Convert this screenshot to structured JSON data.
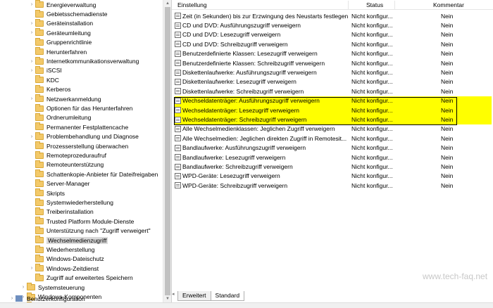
{
  "tree": {
    "items": [
      {
        "label": "Energieverwaltung",
        "expandable": true
      },
      {
        "label": "Gebietsschemadienste",
        "expandable": false
      },
      {
        "label": "Geräteinstallation",
        "expandable": true
      },
      {
        "label": "Geräteumleitung",
        "expandable": true
      },
      {
        "label": "Gruppenrichtlinie",
        "expandable": false
      },
      {
        "label": "Herunterfahren",
        "expandable": false
      },
      {
        "label": "Internetkommunikationsverwaltung",
        "expandable": true
      },
      {
        "label": "iSCSI",
        "expandable": true
      },
      {
        "label": "KDC",
        "expandable": false
      },
      {
        "label": "Kerberos",
        "expandable": false
      },
      {
        "label": "Netzwerkanmeldung",
        "expandable": true
      },
      {
        "label": "Optionen für das Herunterfahren",
        "expandable": false
      },
      {
        "label": "Ordnerumleitung",
        "expandable": false
      },
      {
        "label": "Permanenter Festplattencache",
        "expandable": false
      },
      {
        "label": "Problembehandlung und Diagnose",
        "expandable": true
      },
      {
        "label": "Prozesserstellung überwachen",
        "expandable": false
      },
      {
        "label": "Remoteprozeduraufruf",
        "expandable": false
      },
      {
        "label": "Remoteunterstützung",
        "expandable": false
      },
      {
        "label": "Schattenkopie-Anbieter für Dateifreigaben",
        "expandable": false
      },
      {
        "label": "Server-Manager",
        "expandable": false
      },
      {
        "label": "Skripts",
        "expandable": false
      },
      {
        "label": "Systemwiederherstellung",
        "expandable": false
      },
      {
        "label": "Treiberinstallation",
        "expandable": false
      },
      {
        "label": "Trusted Platform Module-Dienste",
        "expandable": false
      },
      {
        "label": "Unterstützung nach \"Zugriff verweigert\"",
        "expandable": false
      },
      {
        "label": "Wechselmedienzugriff",
        "expandable": false,
        "selected": true
      },
      {
        "label": "Wiederherstellung",
        "expandable": false
      },
      {
        "label": "Windows-Dateischutz",
        "expandable": false
      },
      {
        "label": "Windows-Zeitdienst",
        "expandable": true
      },
      {
        "label": "Zugriff auf erweitertes Speichern",
        "expandable": false
      },
      {
        "label": "Systemsteuerung",
        "expandable": true
      },
      {
        "label": "Windows-Komponenten",
        "expandable": true
      },
      {
        "label": "Alle Einstellungen",
        "expandable": false
      }
    ],
    "bottom_item": "Benutzerkonfiguration"
  },
  "columns": {
    "setting": "Einstellung",
    "status": "Status",
    "comment": "Kommentar"
  },
  "rows": [
    {
      "name": "Zeit (in Sekunden) bis zur Erzwingung des Neustarts festlegen",
      "status": "Nicht konfigur...",
      "comment": "Nein"
    },
    {
      "name": "CD und DVD: Ausführungszugriff verweigern",
      "status": "Nicht konfigur...",
      "comment": "Nein"
    },
    {
      "name": "CD und DVD: Lesezugriff verweigern",
      "status": "Nicht konfigur...",
      "comment": "Nein"
    },
    {
      "name": "CD und DVD: Schreibzugriff verweigern",
      "status": "Nicht konfigur...",
      "comment": "Nein"
    },
    {
      "name": "Benutzerdefinierte Klassen: Lesezugriff verweigern",
      "status": "Nicht konfigur...",
      "comment": "Nein"
    },
    {
      "name": "Benutzerdefinierte Klassen: Schreibzugriff verweigern",
      "status": "Nicht konfigur...",
      "comment": "Nein"
    },
    {
      "name": "Diskettenlaufwerke: Ausführungszugriff verweigern",
      "status": "Nicht konfigur...",
      "comment": "Nein"
    },
    {
      "name": "Diskettenlaufwerke: Lesezugriff verweigern",
      "status": "Nicht konfigur...",
      "comment": "Nein"
    },
    {
      "name": "Diskettenlaufwerke: Schreibzugriff verweigern",
      "status": "Nicht konfigur...",
      "comment": "Nein"
    },
    {
      "name": "Wechseldatenträger: Ausführungszugriff verweigern",
      "status": "Nicht konfigur...",
      "comment": "Nein",
      "highlight": true
    },
    {
      "name": "Wechseldatenträger: Lesezugriff verweigern",
      "status": "Nicht konfigur...",
      "comment": "Nein",
      "highlight": true
    },
    {
      "name": "Wechseldatenträger: Schreibzugriff verweigern",
      "status": "Nicht konfigur...",
      "comment": "Nein",
      "highlight": true
    },
    {
      "name": "Alle Wechselmedienklassen: Jeglichen Zugriff verweigern",
      "status": "Nicht konfigur...",
      "comment": "Nein"
    },
    {
      "name": "Alle Wechselmedien: Jeglichen direkten Zugriff in Remotesit...",
      "status": "Nicht konfigur...",
      "comment": "Nein"
    },
    {
      "name": "Bandlaufwerke: Ausführungszugriff verweigern",
      "status": "Nicht konfigur...",
      "comment": "Nein"
    },
    {
      "name": "Bandlaufwerke: Lesezugriff verweigern",
      "status": "Nicht konfigur...",
      "comment": "Nein"
    },
    {
      "name": "Bandlaufwerke: Schreibzugriff verweigern",
      "status": "Nicht konfigur...",
      "comment": "Nein"
    },
    {
      "name": "WPD-Geräte: Lesezugriff verweigern",
      "status": "Nicht konfigur...",
      "comment": "Nein"
    },
    {
      "name": "WPD-Geräte: Schreibzugriff verweigern",
      "status": "Nicht konfigur...",
      "comment": "Nein"
    }
  ],
  "tabs": [
    {
      "label": "Erweitert",
      "active": false
    },
    {
      "label": "Standard",
      "active": true
    }
  ],
  "watermark": "www.tech-faq.net",
  "colors": {
    "highlight": "#ffff00",
    "folder": "#f3c969",
    "selected": "#d9d9d9"
  }
}
